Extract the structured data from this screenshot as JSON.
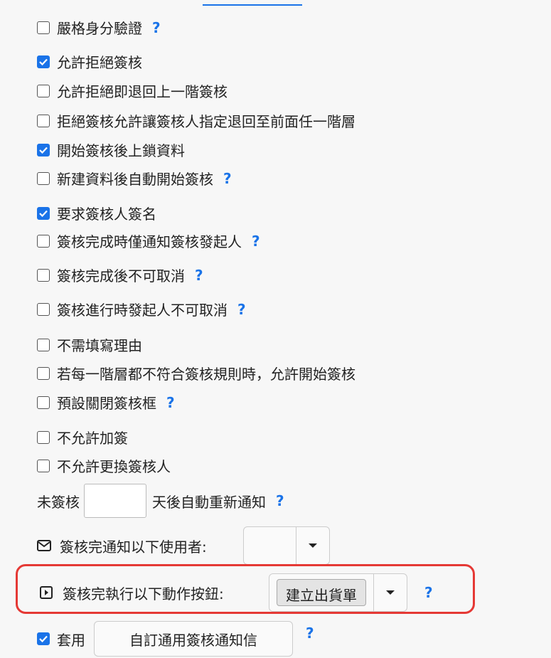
{
  "checkboxes": [
    {
      "label": "嚴格身分驗證",
      "checked": false,
      "help": "?"
    },
    {
      "label": "允許拒絕簽核",
      "checked": true,
      "help": ""
    },
    {
      "label": "允許拒絕即退回上一階簽核",
      "checked": false,
      "help": ""
    },
    {
      "label": "拒絕簽核允許讓簽核人指定退回至前面任一階層",
      "checked": false,
      "help": ""
    },
    {
      "label": "開始簽核後上鎖資料",
      "checked": true,
      "help": ""
    },
    {
      "label": "新建資料後自動開始簽核",
      "checked": false,
      "help": "?"
    },
    {
      "label": "要求簽核人簽名",
      "checked": true,
      "help": ""
    },
    {
      "label": "簽核完成時僅通知簽核發起人",
      "checked": false,
      "help": "?"
    },
    {
      "label": "簽核完成後不可取消",
      "checked": false,
      "help": "?"
    },
    {
      "label": "簽核進行時發起人不可取消",
      "checked": false,
      "help": "?"
    },
    {
      "label": "不需填寫理由",
      "checked": false,
      "help": ""
    },
    {
      "label": "若每一階層都不符合簽核規則時，允許開始簽核",
      "checked": false,
      "help": ""
    },
    {
      "label": "預設關閉簽核框",
      "checked": false,
      "help": "?"
    },
    {
      "label": "不允許加簽",
      "checked": false,
      "help": ""
    },
    {
      "label": "不允許更換簽核人",
      "checked": false,
      "help": ""
    }
  ],
  "reminder": {
    "prefix": "未簽核",
    "value": "",
    "suffix": "天後自動重新通知",
    "help": "?"
  },
  "notify": {
    "label": "簽核完通知以下使用者:",
    "value": ""
  },
  "action": {
    "label": "簽核完執行以下動作按鈕:",
    "selected": "建立出貨單",
    "help": "?"
  },
  "apply": {
    "label": "套用",
    "checked": true,
    "button": "自訂通用簽核通知信",
    "help": "?"
  }
}
